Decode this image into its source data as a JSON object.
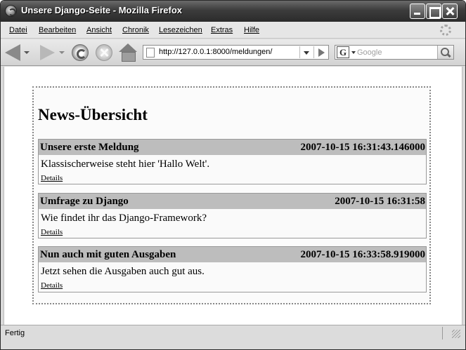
{
  "window": {
    "title": "Unsere Django-Seite - Mozilla Firefox"
  },
  "menu": [
    "Datei",
    "Bearbeiten",
    "Ansicht",
    "Chronik",
    "Lesezeichen",
    "Extras",
    "Hilfe"
  ],
  "nav": {
    "url": "http://127.0.0.1:8000/meldungen/",
    "search_placeholder": "Google",
    "search_engine_letter": "G"
  },
  "page": {
    "heading": "News-Übersicht",
    "news": [
      {
        "title": "Unsere erste Meldung",
        "date": "2007-10-15 16:31:43.146000",
        "text": "Klassischerweise steht hier 'Hallo Welt'.",
        "link": "Details"
      },
      {
        "title": "Umfrage zu Django",
        "date": "2007-10-15 16:31:58",
        "text": "Wie findet ihr das Django-Framework?",
        "link": "Details"
      },
      {
        "title": "Nun auch mit guten Ausgaben",
        "date": "2007-10-15 16:33:58.919000",
        "text": "Jetzt sehen die Ausgaben auch gut aus.",
        "link": "Details"
      }
    ]
  },
  "status": {
    "text": "Fertig"
  }
}
